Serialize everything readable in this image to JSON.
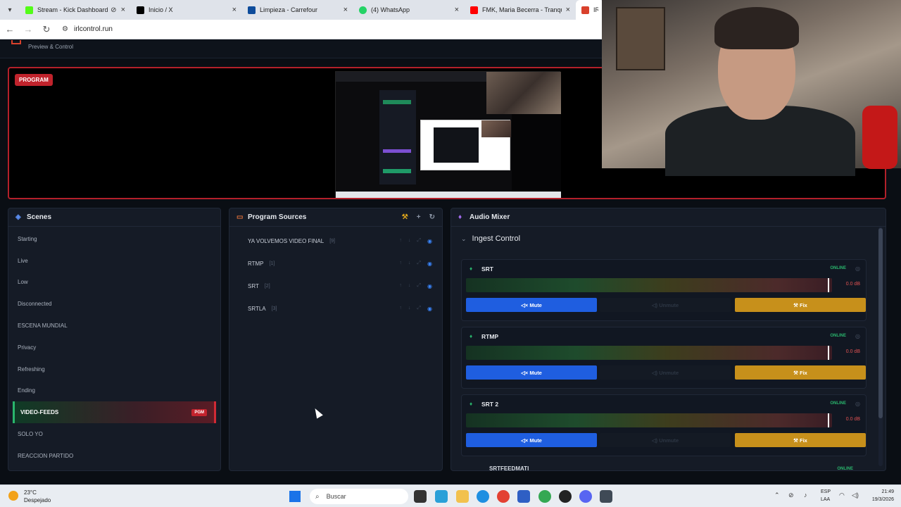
{
  "browser": {
    "tabs": [
      {
        "title": "Stream - Kick Dashboard",
        "color": "#53fc18"
      },
      {
        "title": "Inicio / X",
        "color": "#000000"
      },
      {
        "title": "Limpieza - Carrefour",
        "color": "#0e4c9b"
      },
      {
        "title": "(4) WhatsApp",
        "color": "#25d366"
      },
      {
        "title": "FMK, Maria Becerra - Tranquila",
        "color": "#ff0000"
      },
      {
        "title": "IRL C",
        "color": "#d9412c"
      }
    ],
    "url": "irlcontrol.run"
  },
  "app": {
    "subtitle": "Preview & Control",
    "program_label": "PROGRAM"
  },
  "scenes": {
    "title": "Scenes",
    "items": [
      {
        "label": "Starting"
      },
      {
        "label": "Live"
      },
      {
        "label": "Low"
      },
      {
        "label": "Disconnected"
      },
      {
        "label": "ESCENA MUNDIAL"
      },
      {
        "label": "Privacy"
      },
      {
        "label": "Refreshing"
      },
      {
        "label": "Ending"
      },
      {
        "label": "VIDEO-FEEDS"
      },
      {
        "label": "SOLO YO"
      },
      {
        "label": "REACCION PARTIDO"
      }
    ],
    "active_badge": "PGM"
  },
  "sources": {
    "title": "Program Sources",
    "items": [
      {
        "label": "YA VOLVEMOS VIDEO FINAL",
        "count": "[9]"
      },
      {
        "label": "RTMP",
        "count": "[1]"
      },
      {
        "label": "SRT",
        "count": "[2]"
      },
      {
        "label": "SRTLA",
        "count": "[3]"
      }
    ]
  },
  "mixer": {
    "title": "Audio Mixer",
    "ingest_title": "Ingest Control",
    "channels": [
      {
        "name": "SRT",
        "status": "ONLINE",
        "db": "0.0 dB",
        "mute": "Mute",
        "unmute": "Unmute",
        "fix": "Fix"
      },
      {
        "name": "RTMP",
        "status": "ONLINE",
        "db": "0.0 dB",
        "mute": "Mute",
        "unmute": "Unmute",
        "fix": "Fix"
      },
      {
        "name": "SRT 2",
        "status": "ONLINE",
        "db": "0.0 dB",
        "mute": "Mute",
        "unmute": "Unmute",
        "fix": "Fix"
      }
    ],
    "cut_channel": {
      "name": "SRTFEEDMATI",
      "status": "ONLINE"
    }
  },
  "taskbar": {
    "temp": "23°C",
    "weather": "Despejado",
    "search": "Buscar",
    "lang1": "ESP",
    "lang2": "LAA",
    "time": "21:49",
    "date": "19/3/2026"
  }
}
